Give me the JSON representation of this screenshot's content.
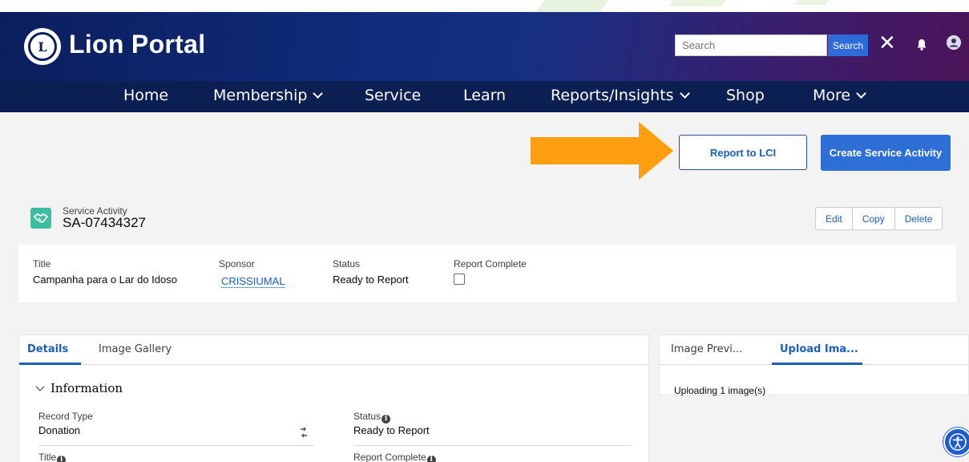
{
  "app": {
    "brand": "Lion Portal",
    "logo_icon": "lions-logo-icon"
  },
  "search": {
    "placeholder": "Search",
    "button_label": "Search",
    "close_symbol": "✕"
  },
  "nav": {
    "home": "Home",
    "membership": "Membership",
    "service": "Service",
    "learn": "Learn",
    "reports": "Reports/Insights",
    "shop": "Shop",
    "more": "More"
  },
  "actions": {
    "report_to_lci": "Report to LCI",
    "create_service_activity": "Create Service Activity"
  },
  "record": {
    "object_label": "Service Activity",
    "record_id": "SA-07434327",
    "buttons": {
      "edit": "Edit",
      "copy": "Copy",
      "delete": "Delete"
    }
  },
  "highlights": {
    "title_label": "Title",
    "title_value": "Campanha para o Lar do Idoso",
    "sponsor_label": "Sponsor",
    "sponsor_value": "CRISSIUMAL",
    "status_label": "Status",
    "status_value": "Ready to Report",
    "report_complete_label": "Report Complete",
    "report_complete_checked": false
  },
  "details": {
    "tabs": {
      "details": "Details",
      "image_gallery": "Image Gallery"
    },
    "section_title": "Information",
    "record_type_label": "Record Type",
    "record_type_value": "Donation",
    "status_label": "Status",
    "status_value": "Ready to Report",
    "title_label": "Title",
    "report_complete_label": "Report Complete"
  },
  "side": {
    "tabs": {
      "image_preview": "Image Previ...",
      "upload_image": "Upload Ima..."
    },
    "message": "Uploading 1 image(s)"
  },
  "colors": {
    "header_dark": "#0c1f52",
    "accent_blue": "#2d6fd6",
    "link_blue": "#1b5fb8",
    "arrow_orange": "#ff9f0f",
    "record_icon_teal": "#3ebea0"
  }
}
